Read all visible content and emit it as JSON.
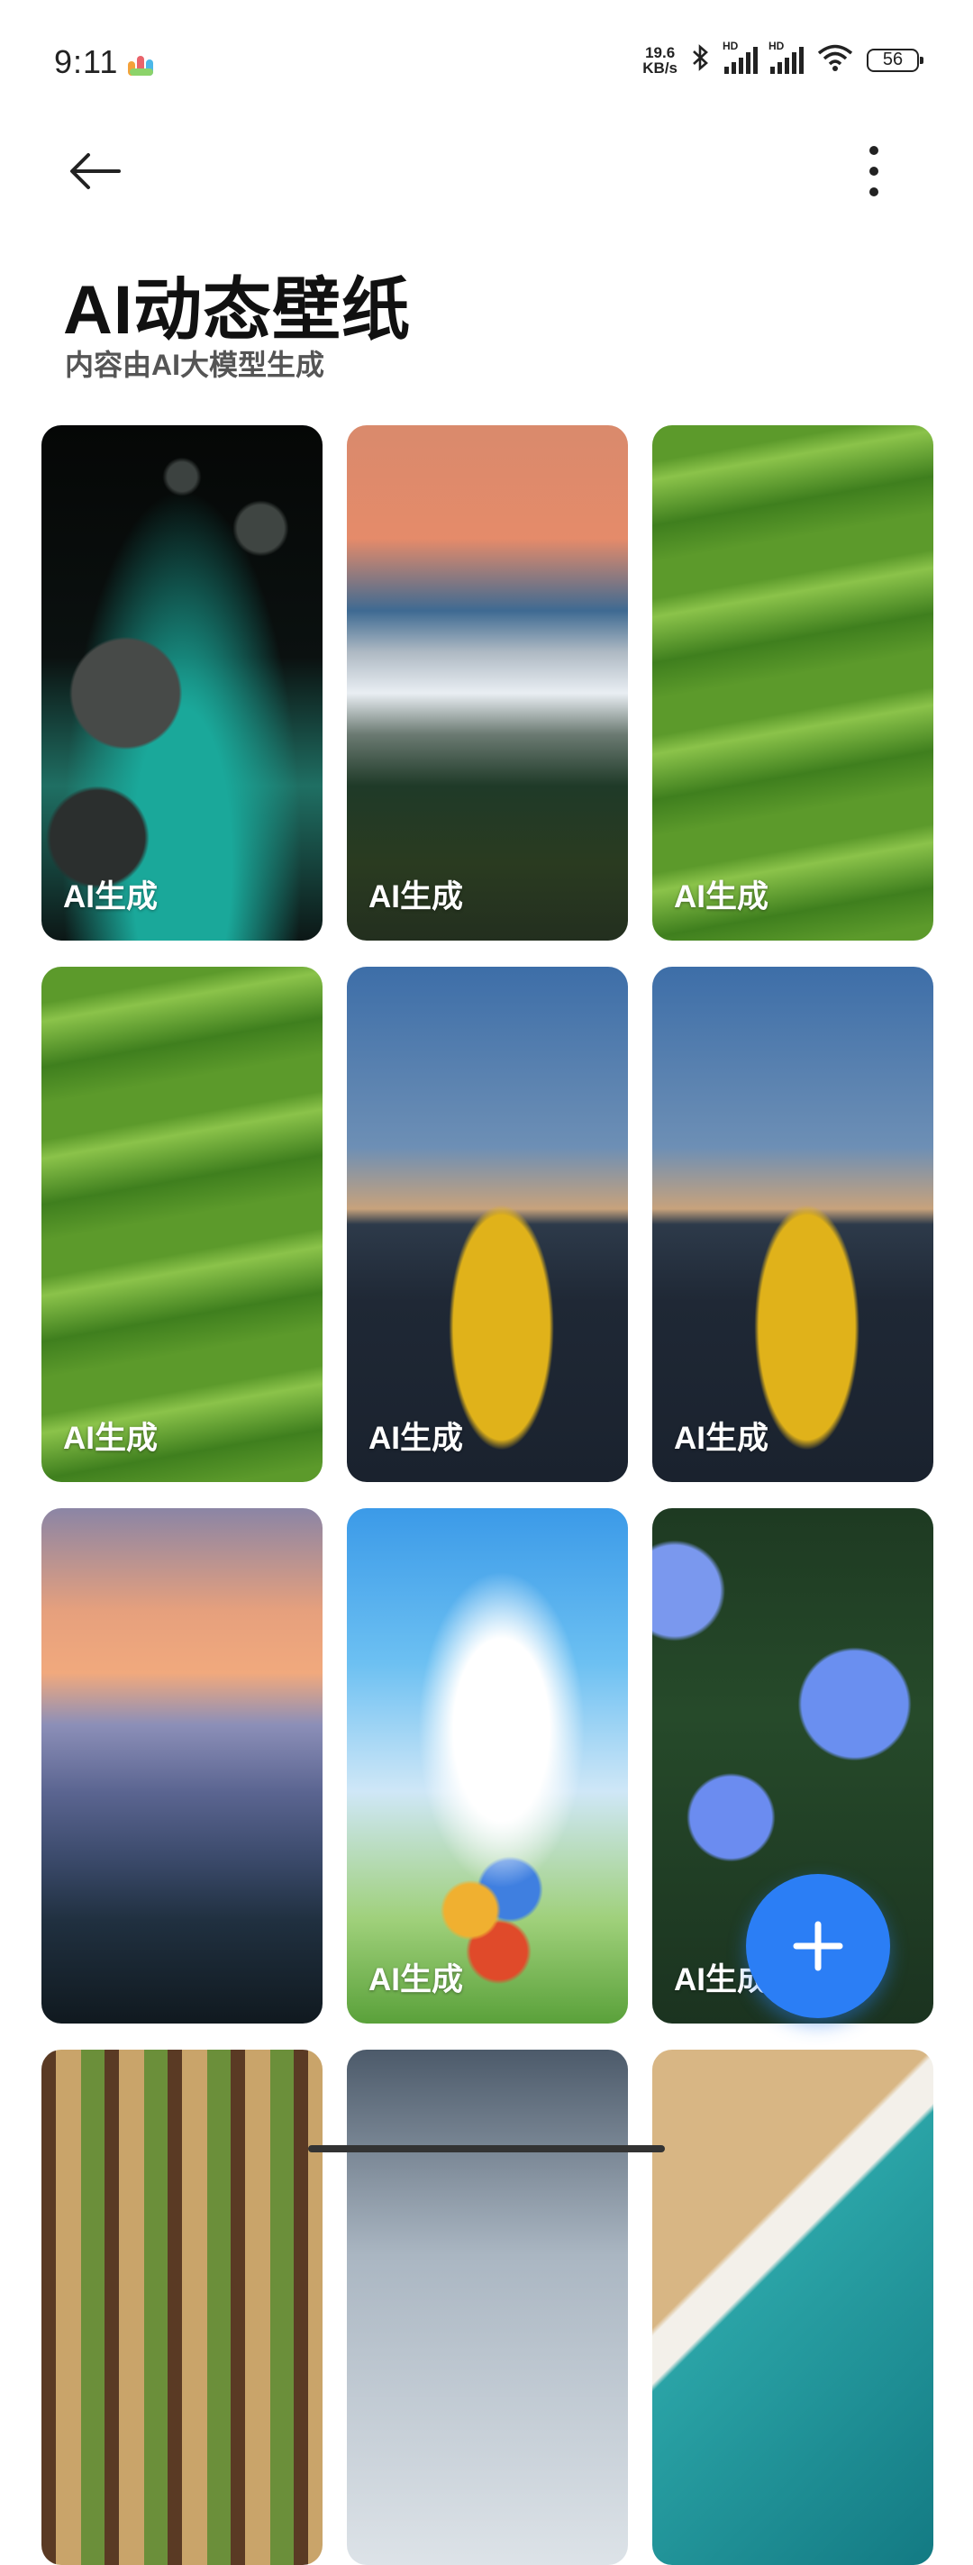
{
  "status_bar": {
    "time": "9:11",
    "net_speed_value": "19.6",
    "net_speed_unit": "KB/s",
    "signal_1_label": "HD",
    "signal_2_label": "HD",
    "battery": "56"
  },
  "header": {
    "title": "AI动态壁纸",
    "subtitle": "内容由AI大模型生成"
  },
  "grid": {
    "items": [
      {
        "label": "AI生成"
      },
      {
        "label": "AI生成"
      },
      {
        "label": "AI生成"
      },
      {
        "label": "AI生成"
      },
      {
        "label": "AI生成"
      },
      {
        "label": "AI生成"
      },
      {
        "label": ""
      },
      {
        "label": "AI生成"
      },
      {
        "label": "AI生成"
      }
    ]
  },
  "fab": {
    "icon": "plus-icon"
  },
  "colors": {
    "accent": "#2b7ef5"
  }
}
